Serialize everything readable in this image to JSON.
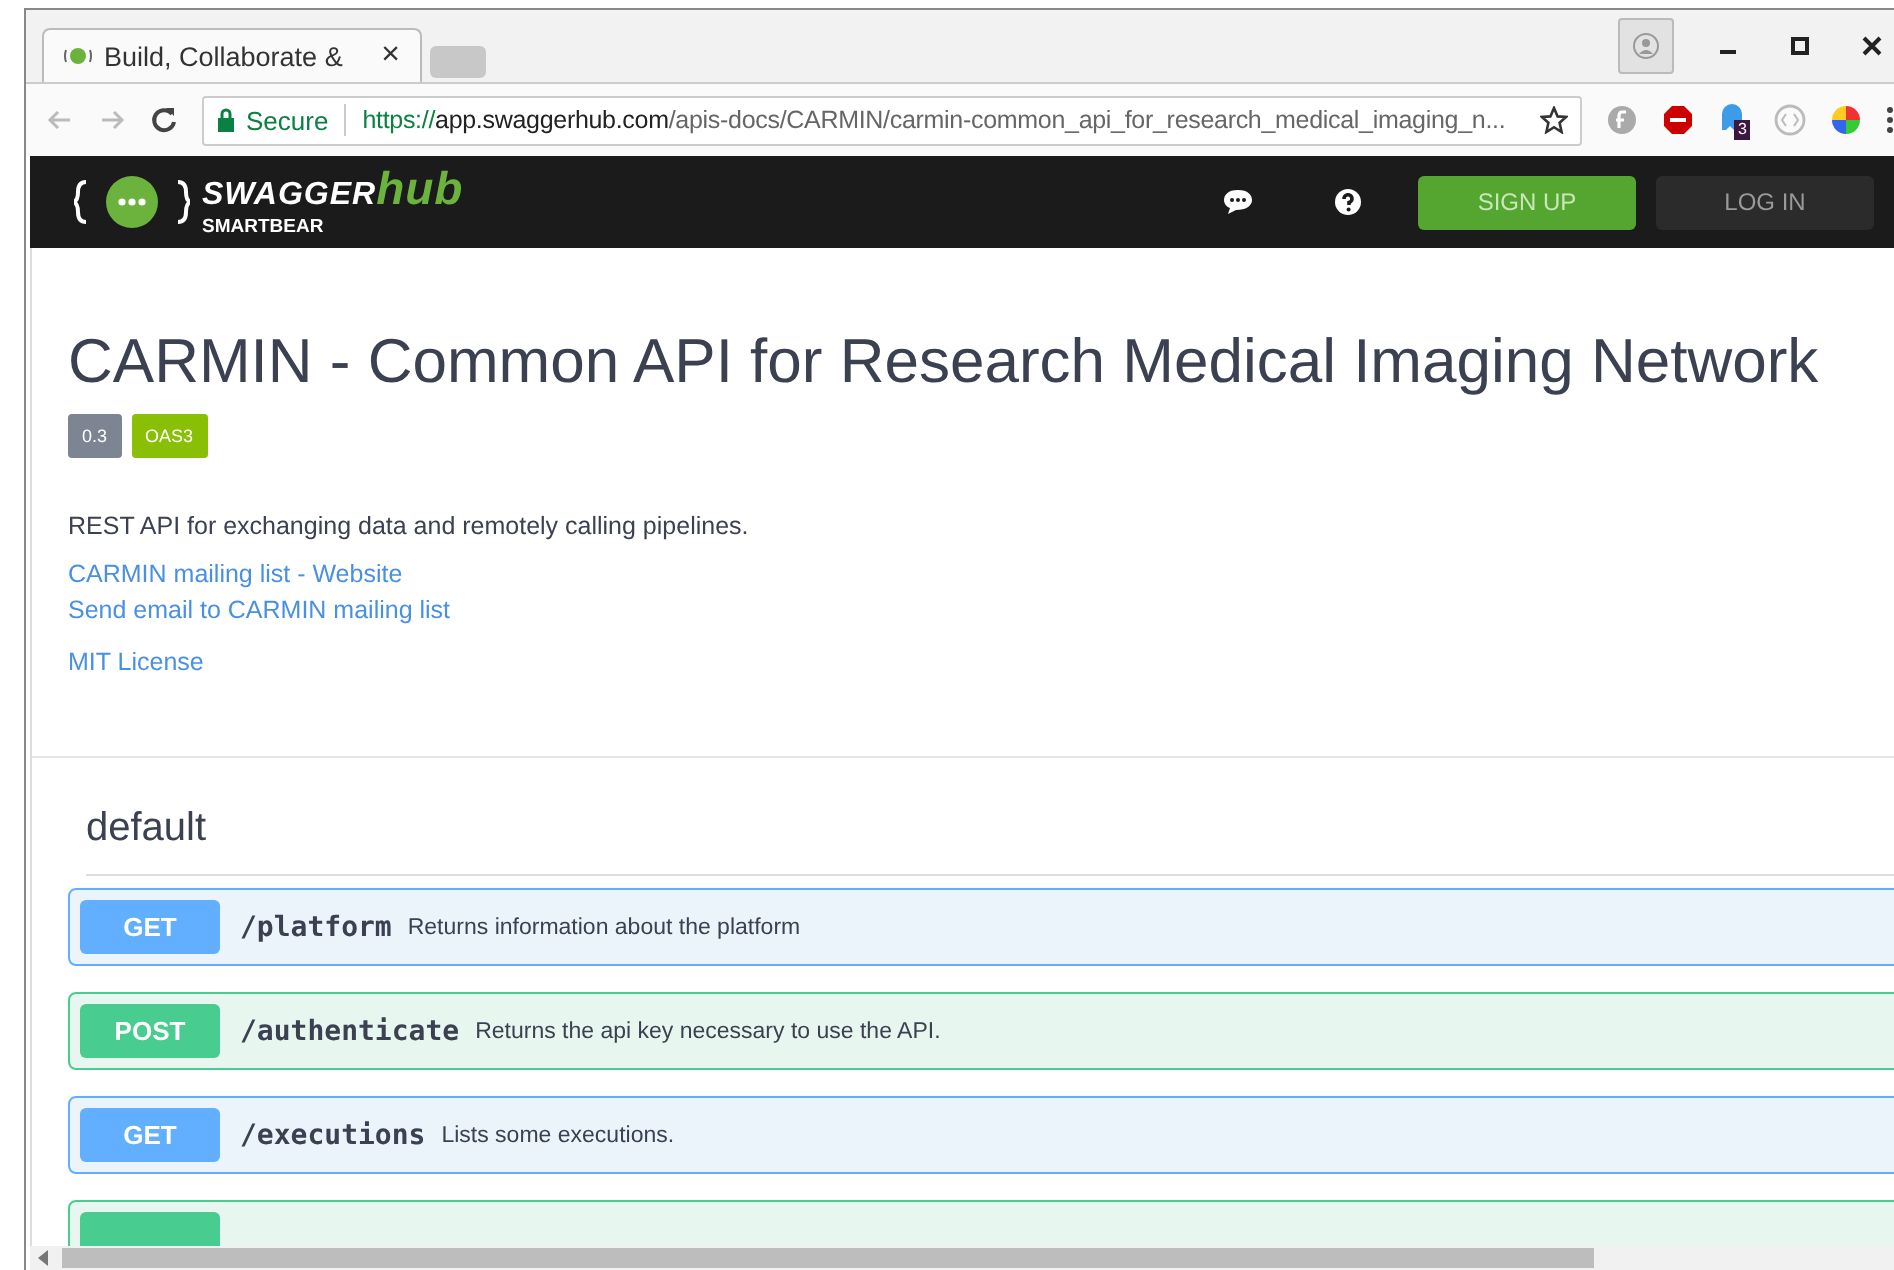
{
  "browser": {
    "tab_title": "Build, Collaborate &",
    "tab_close": "×",
    "secure_label": "Secure",
    "url_scheme": "https://",
    "url_host": "app.swaggerhub.com",
    "url_path": "/apis-docs/CARMIN/carmin-common_api_for_research_medical_imaging_n...",
    "extension_badge": "3"
  },
  "header": {
    "brand": "SWAGGER",
    "brand_accent": "hub",
    "brand_sub": "SMARTBEAR",
    "buttons": [
      {
        "label": "SIGN UP",
        "kind": "primary"
      },
      {
        "label": "LOG IN",
        "kind": "dark"
      }
    ]
  },
  "info": {
    "title": "CARMIN - Common API for Research Medical Imaging Network",
    "badges": [
      {
        "label": "0.3",
        "color": "#7d8492"
      },
      {
        "label": "OAS3",
        "color": "#89bf04"
      }
    ],
    "description": "REST API for exchanging data and remotely calling pipelines.",
    "links": [
      "CARMIN mailing list - Website",
      "Send email to CARMIN mailing list"
    ],
    "license": "MIT License"
  },
  "section": {
    "title": "default"
  },
  "operations": [
    {
      "kind": "get",
      "method": "GET",
      "path": "/platform",
      "summary": "Returns information about the platform"
    },
    {
      "kind": "post",
      "method": "POST",
      "path": "/authenticate",
      "summary": "Returns the api key necessary to use the API."
    },
    {
      "kind": "get",
      "method": "GET",
      "path": "/executions",
      "summary": "Lists some executions."
    },
    {
      "kind": "post"
    }
  ]
}
